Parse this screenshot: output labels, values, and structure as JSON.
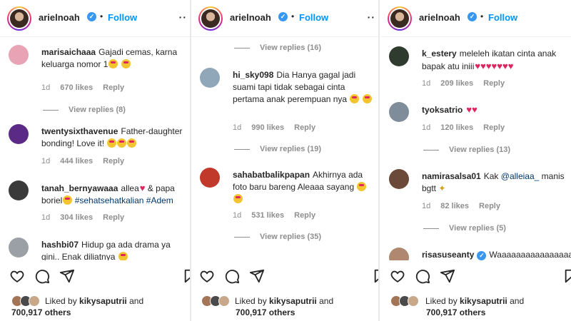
{
  "colors": {
    "follow": "#0095f6",
    "verified": "#3897f0",
    "muted": "#8e8e8e",
    "text": "#262626",
    "heart": "#e0245e"
  },
  "panels": [
    {
      "header": {
        "username": "arielnoah",
        "dot": "•",
        "follow": "Follow",
        "more": "··"
      },
      "comments": [
        {
          "user": "marisaichaaa",
          "text": "Gajadi cemas, karna keluarga nomor 1",
          "age": "1d",
          "likes": "670 likes",
          "reply": "Reply",
          "view_replies": "View replies (8)"
        },
        {
          "user": "twentysixthavenue",
          "text": "Father-daughter bonding! Love it!",
          "age": "1d",
          "likes": "444 likes",
          "reply": "Reply"
        },
        {
          "user": "tanah_bernyawaaa",
          "text_a": "allea",
          "text_b": "& papa boriel",
          "tags": "#sehatsehatkalian #Adem",
          "age": "1d",
          "likes": "304 likes",
          "reply": "Reply"
        },
        {
          "user": "hashbi07",
          "text": "Hidup ga ada drama ya gini.. Enak diliatnya"
        }
      ],
      "likes": {
        "prefix": "Liked by",
        "user": "kikysaputrii",
        "suffix": "and",
        "others": "700,917 others"
      }
    },
    {
      "header": {
        "username": "arielnoah",
        "dot": "•",
        "follow": "Follow",
        "more": "··"
      },
      "comments": [
        {
          "view_replies_top": "View replies (16)"
        },
        {
          "user": "hi_sky098",
          "text": "Dia Hanya gagal jadi suami tapi tidak sebagai cinta pertama anak perempuan nya",
          "age": "1d",
          "likes": "990 likes",
          "reply": "Reply",
          "view_replies": "View replies (19)"
        },
        {
          "user": "sahabatbalikpapan",
          "text": "Akhirnya ada foto baru bareng Aleaaa sayang",
          "age": "1d",
          "likes": "531 likes",
          "reply": "Reply",
          "view_replies": "View replies (35)"
        }
      ],
      "likes": {
        "prefix": "Liked by",
        "user": "kikysaputrii",
        "suffix": "and",
        "others": "700,917 others"
      }
    },
    {
      "header": {
        "username": "arielnoah",
        "follow": "Follow"
      },
      "comments": [
        {
          "user": "k_estery",
          "text": "meleleh ikatan cinta anak bapak atu iniii",
          "age": "1d",
          "likes": "209 likes",
          "reply": "Reply"
        },
        {
          "user": "tyoksatrio",
          "text": "",
          "age": "1d",
          "likes": "120 likes",
          "reply": "Reply",
          "view_replies": "View replies (13)"
        },
        {
          "user": "namirasalsa01",
          "text_a": "Kak",
          "tag": "@alleiaa_",
          "text_b": "manis bgtt",
          "age": "1d",
          "likes": "82 likes",
          "reply": "Reply",
          "view_replies": "View replies (5)"
        },
        {
          "user": "risasuseanty",
          "text": "Waaaaaaaaaaaaaaaa"
        }
      ],
      "likes": {
        "prefix": "Liked by",
        "user": "kikysaputrii",
        "suffix": "and",
        "others": "700,917 others"
      }
    }
  ],
  "icons": [
    "heart-icon",
    "comment-icon",
    "share-icon",
    "bookmark-icon"
  ]
}
